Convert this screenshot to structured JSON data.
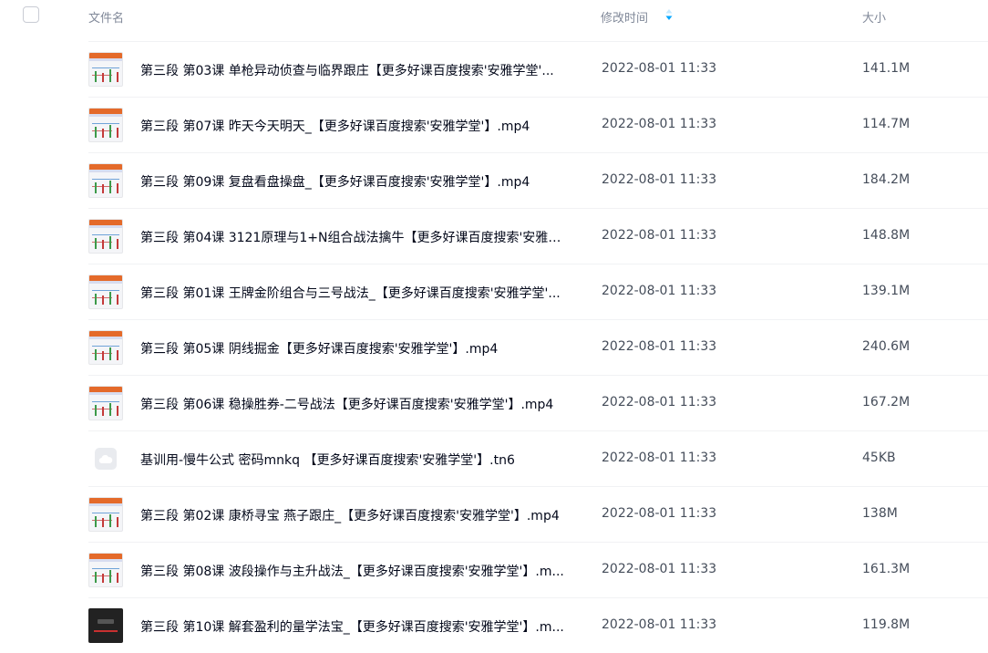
{
  "header": {
    "name_label": "文件名",
    "time_label": "修改时间",
    "size_label": "大小",
    "sort_icon": "sort-desc-icon",
    "accent_color": "#06a7ff"
  },
  "rows": [
    {
      "name": "第三段 第03课 单枪异动侦查与临界跟庄【更多好课百度搜索'安雅学堂'...",
      "time": "2022-08-01 11:33",
      "size": "141.1M",
      "thumb": "video"
    },
    {
      "name": "第三段 第07课 昨天今天明天_【更多好课百度搜索'安雅学堂'】.mp4",
      "time": "2022-08-01 11:33",
      "size": "114.7M",
      "thumb": "video"
    },
    {
      "name": "第三段 第09课 复盘看盘操盘_【更多好课百度搜索'安雅学堂'】.mp4",
      "time": "2022-08-01 11:33",
      "size": "184.2M",
      "thumb": "video"
    },
    {
      "name": "第三段 第04课 3121原理与1+N组合战法擒牛【更多好课百度搜索'安雅学...",
      "time": "2022-08-01 11:33",
      "size": "148.8M",
      "thumb": "video"
    },
    {
      "name": "第三段 第01课 王牌金阶组合与三号战法_【更多好课百度搜索'安雅学堂'...",
      "time": "2022-08-01 11:33",
      "size": "139.1M",
      "thumb": "video"
    },
    {
      "name": "第三段 第05课 阴线掘金【更多好课百度搜索'安雅学堂'】.mp4",
      "time": "2022-08-01 11:33",
      "size": "240.6M",
      "thumb": "video"
    },
    {
      "name": "第三段 第06课 稳操胜券-二号战法【更多好课百度搜索'安雅学堂'】.mp4",
      "time": "2022-08-01 11:33",
      "size": "167.2M",
      "thumb": "video"
    },
    {
      "name": "基训用-慢牛公式 密码mnkq 【更多好课百度搜索'安雅学堂'】.tn6",
      "time": "2022-08-01 11:33",
      "size": "45KB",
      "thumb": "file"
    },
    {
      "name": "第三段 第02课 康桥寻宝 燕子跟庄_【更多好课百度搜索'安雅学堂'】.mp4",
      "time": "2022-08-01 11:33",
      "size": "138M",
      "thumb": "video"
    },
    {
      "name": "第三段 第08课 波段操作与主升战法_【更多好课百度搜索'安雅学堂'】.m...",
      "time": "2022-08-01 11:33",
      "size": "161.3M",
      "thumb": "video"
    },
    {
      "name": "第三段 第10课 解套盈利的量学法宝_【更多好课百度搜索'安雅学堂'】.m...",
      "time": "2022-08-01 11:33",
      "size": "119.8M",
      "thumb": "dark"
    }
  ]
}
